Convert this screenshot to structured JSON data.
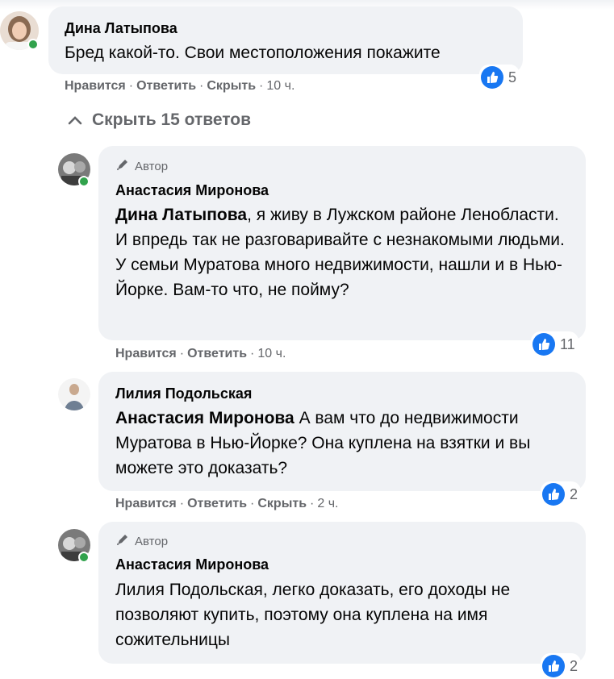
{
  "comment1": {
    "name": "Дина Латыпова",
    "text": "Бред какой-то. Свои местоположения покажите",
    "like_label": "Нравится",
    "reply_label": "Ответить",
    "hide_label": "Скрыть",
    "time": "10 ч.",
    "reaction_count": "5"
  },
  "replies_toggle": {
    "label": "Скрыть 15 ответов"
  },
  "reply1": {
    "badge": "Автор",
    "name": "Анастасия Миронова",
    "mention": "Дина Латыпова",
    "text": ", я живу в Лужском районе Ленобласти. И впредь так не разговаривайте с незнакомыми людьми. У семьи Муратова много недвижимости, нашли и в Нью-Йорке. Вам-то что, не пойму?",
    "like_label": "Нравится",
    "reply_label": "Ответить",
    "time": "10 ч.",
    "reaction_count": "11"
  },
  "reply2": {
    "name": "Лилия Подольская",
    "mention": "Анастасия Миронова",
    "text": " А вам что до недвижимости Муратова в Нью-Йорке? Она куплена на взятки и вы можете это доказать?",
    "like_label": "Нравится",
    "reply_label": "Ответить",
    "hide_label": "Скрыть",
    "time": "2 ч.",
    "reaction_count": "2"
  },
  "reply3": {
    "badge": "Автор",
    "name": "Анастасия Миронова",
    "text": "Лилия Подольская, легко доказать, его доходы не позволяют купить, поэтому она куплена на имя сожительницы",
    "reaction_count": "2"
  },
  "colors": {
    "bubble": "#f0f2f5",
    "meta": "#65676b",
    "like": "#1877f2",
    "online": "#31a24c"
  }
}
